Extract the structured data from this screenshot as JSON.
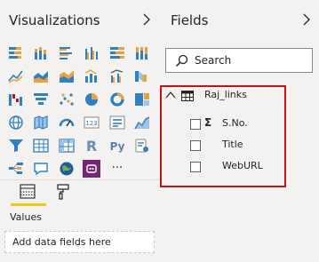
{
  "visualizations": {
    "title": "Visualizations",
    "collapse_icon": "chevron-right-icon",
    "tiles": [
      "stacked-bar-chart",
      "stacked-column-chart",
      "clustered-bar-chart",
      "clustered-column-chart",
      "100-stacked-bar-chart",
      "100-stacked-column-chart",
      "line-chart",
      "area-chart",
      "stacked-area-chart",
      "line-and-stacked-column-chart",
      "line-and-clustered-column-chart",
      "ribbon-chart",
      "waterfall-chart",
      "funnel-chart",
      "scatter-chart",
      "pie-chart",
      "donut-chart",
      "treemap",
      "map",
      "filled-map",
      "gauge",
      "card",
      "multi-row-card",
      "kpi",
      "slicer",
      "table",
      "matrix",
      "r-script-visual",
      "python-visual",
      "key-influencers",
      "decomposition-tree",
      "qa-visual",
      "arcgis-map",
      "power-apps",
      "more-visuals"
    ],
    "r_label": "R",
    "py_label": "Py",
    "more_label": "···",
    "wells": {
      "active_tab": "fields-tab",
      "values_label": "Values",
      "drop_placeholder": "Add data fields here"
    },
    "accent": "#f2c811"
  },
  "fields": {
    "title": "Fields",
    "collapse_icon": "chevron-right-icon",
    "search_placeholder": "Search",
    "table": {
      "name": "Raj_links",
      "expanded": true,
      "items": [
        {
          "name": "S.No.",
          "aggregate": true,
          "aggregate_symbol": "Σ",
          "checked": false
        },
        {
          "name": "Title",
          "aggregate": false,
          "checked": false
        },
        {
          "name": "WebURL",
          "aggregate": false,
          "checked": false
        }
      ]
    },
    "highlight_color": "#c0141d"
  }
}
